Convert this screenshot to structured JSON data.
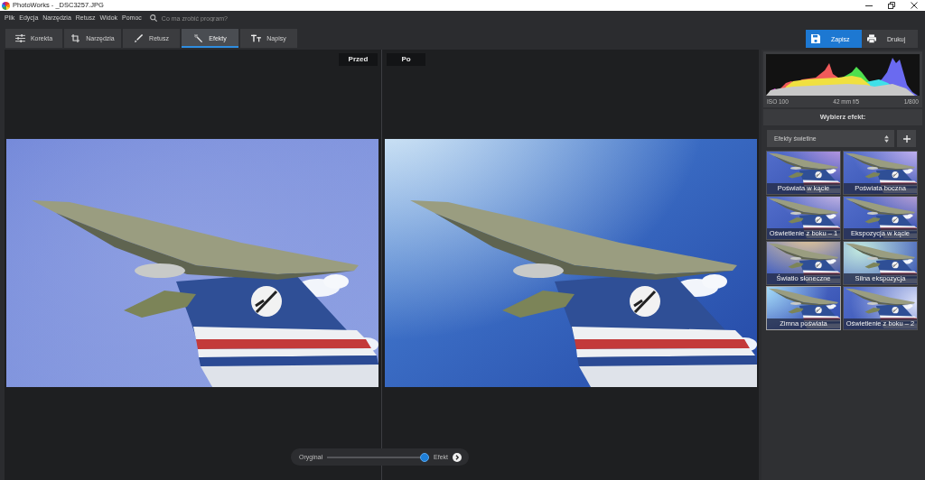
{
  "window": {
    "title": "PhotoWorks - _DSC3257.JPG"
  },
  "menu": [
    "Plik",
    "Edycja",
    "Narzędzia",
    "Retusz",
    "Widok",
    "Pomoc"
  ],
  "search": {
    "placeholder": "Co ma zrobić program?"
  },
  "tabs": [
    {
      "label": "Korekta",
      "selected": false
    },
    {
      "label": "Narzędzia",
      "selected": false
    },
    {
      "label": "Retusz",
      "selected": false
    },
    {
      "label": "Efekty",
      "selected": true
    },
    {
      "label": "Napisy",
      "selected": false
    }
  ],
  "actions": [
    {
      "label": "Zapisz",
      "primary": true
    },
    {
      "label": "Drukuj",
      "primary": false
    }
  ],
  "compare": {
    "before": "Przed",
    "after": "Po"
  },
  "blend": {
    "start_label": "Oryginał",
    "end_label": "Efekt",
    "level": 1
  },
  "photo_info": {
    "iso": "ISO 100",
    "lens": "42 mm f/5",
    "shutter": "1/800"
  },
  "effects_panel": {
    "title": "Wybierz efekt:",
    "category": "Efekty świetlne",
    "effects": [
      {
        "label": "Poświata w kącie",
        "selected": false
      },
      {
        "label": "Poświata boczna",
        "selected": false
      },
      {
        "label": "Oświetlenie z boku – 1",
        "selected": false
      },
      {
        "label": "Ekspozycja w kącie",
        "selected": false
      },
      {
        "label": "Światło słoneczne",
        "selected": false
      },
      {
        "label": "Silna ekspozycja",
        "selected": false
      },
      {
        "label": "Zimna poświata",
        "selected": true
      },
      {
        "label": "Oświetlenie z boku – 2",
        "selected": false
      }
    ]
  }
}
